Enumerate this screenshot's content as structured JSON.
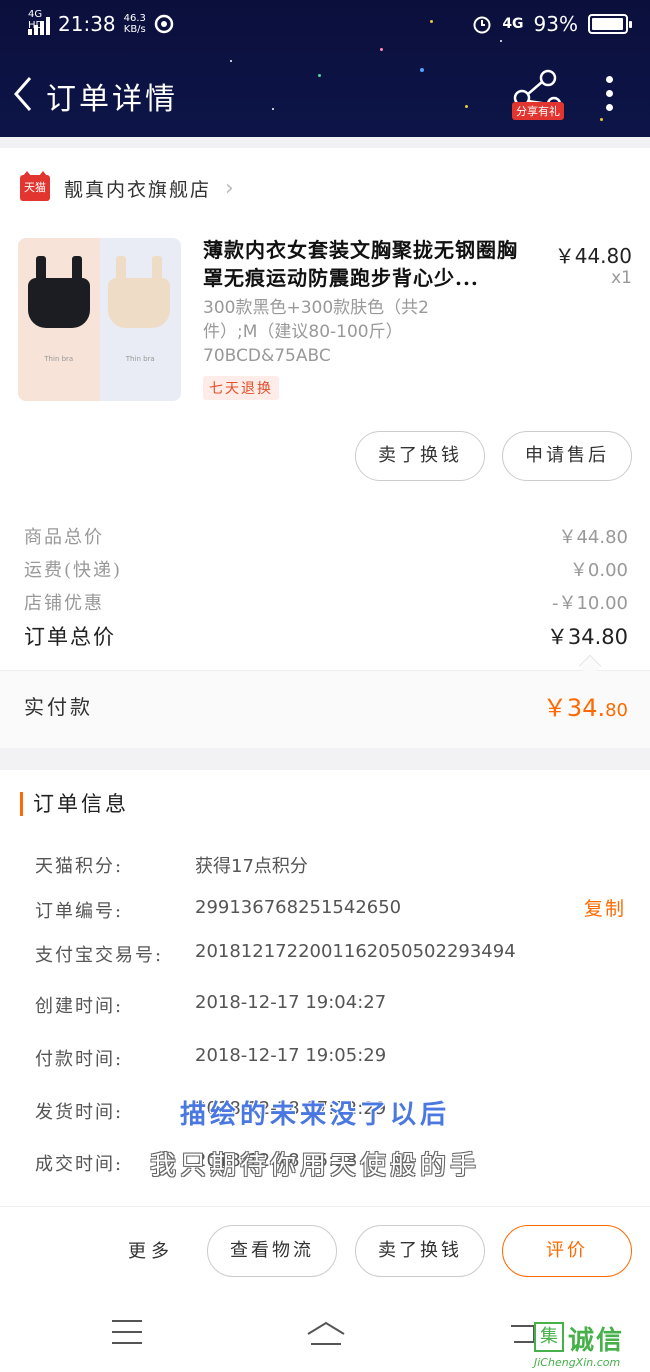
{
  "status_bar": {
    "network": "4G HD",
    "time": "21:38",
    "speed_top": "46.3",
    "speed_bottom": "KB/s",
    "net_right": "4G",
    "battery": "93%"
  },
  "nav": {
    "title": "订单详情",
    "share_badge": "分享有礼"
  },
  "shop": {
    "logo": "天猫",
    "name": "靓真内衣旗舰店"
  },
  "product": {
    "title": "薄款内衣女套装文胸聚拢无钢圈胸罩无痕运动防震跑步背心少...",
    "price": "￥44.80",
    "qty": "x1",
    "sku": "300款黑色+300款肤色（共2件）;M（建议80-100斤）70BCD&75ABC",
    "tag": "七天退换",
    "thumb_text": "Thin bra"
  },
  "actions": {
    "sell": "卖了换钱",
    "after_sale": "申请售后"
  },
  "summary": {
    "goods_total_label": "商品总价",
    "goods_total": "￥44.80",
    "shipping_label": "运费(快递)",
    "shipping": "￥0.00",
    "discount_label": "店铺优惠",
    "discount": "-￥10.00",
    "order_total_label": "订单总价",
    "order_total": "￥34.80",
    "paid_label": "实付款",
    "paid_main": "￥34.",
    "paid_decimal": "80"
  },
  "order_info": {
    "title": "订单信息",
    "copy": "复制",
    "rows": [
      {
        "key": "天猫积分:",
        "value": "获得17点积分"
      },
      {
        "key": "订单编号:",
        "value": "299136768251542650"
      },
      {
        "key": "支付宝交易号:",
        "value": "2018121722001162050502293494"
      },
      {
        "key": "创建时间:",
        "value": "2018-12-17 19:04:27"
      },
      {
        "key": "付款时间:",
        "value": "2018-12-17 19:05:29"
      },
      {
        "key": "发货时间:",
        "value": "2018-12-18 07:22:29"
      },
      {
        "key": "成交时间:",
        "value": "2018-12-18 15:38"
      }
    ]
  },
  "subtitles": {
    "line1": "描绘的未来没了以后",
    "line2": "我只期待你用天使般的手"
  },
  "bottom_bar": {
    "more": "更多",
    "logistics": "查看物流",
    "sell": "卖了换钱",
    "rate": "评价"
  },
  "watermark": {
    "box": "集",
    "text": "诚信",
    "url": "JiChengXin.com"
  },
  "colors": {
    "header_bg": "#0b0f3c",
    "accent": "#ff6a00",
    "tmall_red": "#e3352f"
  }
}
